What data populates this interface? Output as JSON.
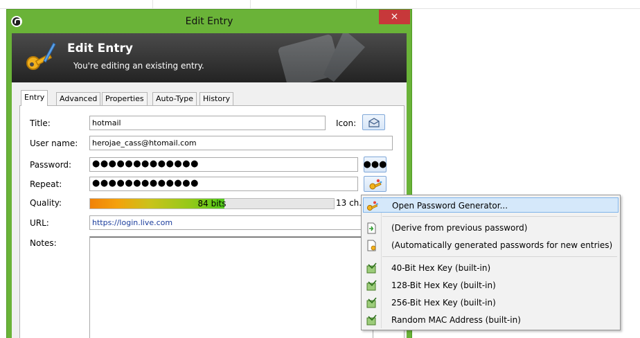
{
  "window": {
    "title": "Edit Entry",
    "close_label": "×"
  },
  "banner": {
    "heading": "Edit Entry",
    "subtitle": "You're editing an existing entry."
  },
  "tabs": [
    {
      "label": "Entry",
      "active": true
    },
    {
      "label": "Advanced",
      "active": false
    },
    {
      "label": "Properties",
      "active": false
    },
    {
      "label": "Auto-Type",
      "active": false
    },
    {
      "label": "History",
      "active": false
    }
  ],
  "form": {
    "title_label": "Title:",
    "title_value": "hotmail",
    "icon_label": "Icon:",
    "username_label": "User name:",
    "username_value": "herojae_cass@htomail.com",
    "password_label": "Password:",
    "password_value": "●●●●●●●●●●●●●",
    "reveal_button_label": "●●●",
    "repeat_label": "Repeat:",
    "repeat_value": "●●●●●●●●●●●●●",
    "quality_label": "Quality:",
    "quality_text": "84 bits",
    "quality_fraction": 0.55,
    "char_count": "13 ch.",
    "url_label": "URL:",
    "url_value": "https://login.live.com",
    "notes_label": "Notes:",
    "notes_value": ""
  },
  "menu": {
    "items": [
      {
        "label": "Open Password Generator...",
        "icon": "password-generator-icon",
        "highlighted": true
      },
      {
        "label": "(Derive from previous password)",
        "icon": "derive-document-icon",
        "highlighted": false
      },
      {
        "label": "(Automatically generated passwords for new entries)",
        "icon": "auto-generate-document-icon",
        "highlighted": false
      },
      {
        "label": "40-Bit Hex Key (built-in)",
        "icon": "profile-icon",
        "highlighted": false
      },
      {
        "label": "128-Bit Hex Key (built-in)",
        "icon": "profile-icon",
        "highlighted": false
      },
      {
        "label": "256-Bit Hex Key (built-in)",
        "icon": "profile-icon",
        "highlighted": false
      },
      {
        "label": "Random MAC Address (built-in)",
        "icon": "profile-icon",
        "highlighted": false
      }
    ]
  },
  "colors": {
    "window_frame": "#6ab338",
    "close_button": "#c7383a",
    "menu_highlight": "#d5e8fa"
  }
}
